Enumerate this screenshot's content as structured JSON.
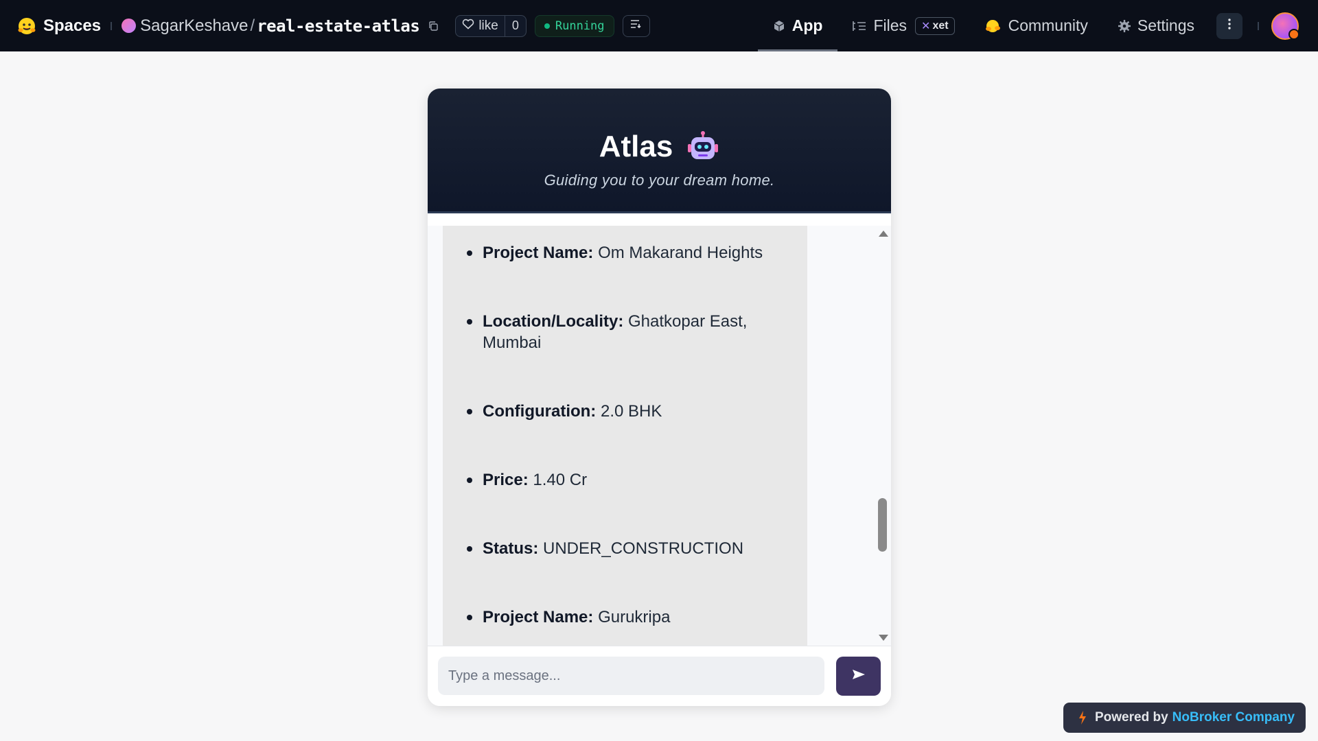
{
  "topbar": {
    "logo_icon": "hugging-face-icon",
    "spaces_label": "Spaces",
    "owner": "SagarKeshave",
    "separator": "/",
    "repo": "real-estate-atlas",
    "like_label": "like",
    "like_count": "0",
    "status": "Running",
    "status_color": "#10b981",
    "tabs": [
      {
        "label": "App",
        "icon": "cube-icon",
        "active": true
      },
      {
        "label": "Files",
        "icon": "files-icon",
        "active": false
      },
      {
        "label": "Community",
        "icon": "community-icon",
        "active": false
      },
      {
        "label": "Settings",
        "icon": "gear-icon",
        "active": false
      }
    ],
    "xet_badge": "xet"
  },
  "chat": {
    "title": "Atlas",
    "title_icon": "robot-icon",
    "subtitle": "Guiding you to your dream home.",
    "items": [
      {
        "label": "Project Name:",
        "value": "Om Makarand Heights"
      },
      {
        "label": "Location/Locality:",
        "value": "Ghatkopar East, Mumbai"
      },
      {
        "label": "Configuration:",
        "value": "2.0 BHK"
      },
      {
        "label": "Price:",
        "value": "1.40 Cr"
      },
      {
        "label": "Status:",
        "value": "UNDER_CONSTRUCTION"
      },
      {
        "label": "Project Name:",
        "value": "Gurukripa"
      }
    ],
    "input_placeholder": "Type a message...",
    "input_value": "",
    "send_icon": "send-arrow-icon",
    "accent_color": "#3e3463"
  },
  "footer": {
    "powered_prefix": "Powered by",
    "powered_brand": "NoBroker Company",
    "brand_color": "#38bdf8",
    "bolt_icon": "lightning-icon"
  }
}
